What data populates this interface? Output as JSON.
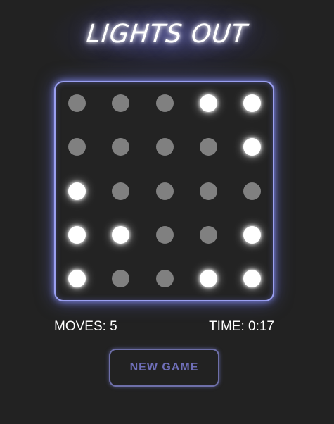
{
  "title": "LIGHTS OUT",
  "board": {
    "rows": 5,
    "cols": 5,
    "cells": [
      [
        false,
        false,
        false,
        true,
        true
      ],
      [
        false,
        false,
        false,
        false,
        true
      ],
      [
        true,
        false,
        false,
        false,
        false
      ],
      [
        true,
        true,
        false,
        false,
        true
      ],
      [
        true,
        false,
        false,
        true,
        true
      ]
    ]
  },
  "stats": {
    "moves": "MOVES: 5",
    "time": "TIME: 0:17"
  },
  "new_game_label": "NEW GAME",
  "colors": {
    "background": "#222222",
    "light_on": "#ffffff",
    "light_off": "#808080",
    "board_border": "#9a9ff0",
    "button_accent": "#6f6fb8"
  }
}
